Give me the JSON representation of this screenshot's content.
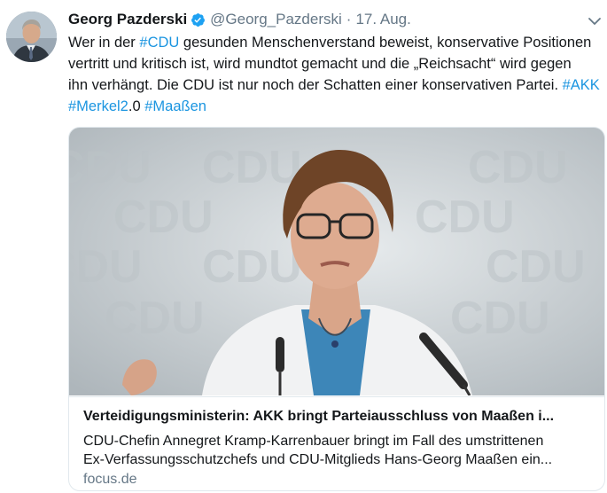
{
  "tweet": {
    "author_name": "Georg Pazderski",
    "handle": "@Georg_Pazderski",
    "separator": "·",
    "date": "17. Aug.",
    "text_lines": [
      [
        {
          "t": "Wer in der ",
          "tag": false
        },
        {
          "t": "#CDU",
          "tag": true
        },
        {
          "t": " gesunden Menschenverstand beweist, konservative Positionen",
          "tag": false
        }
      ],
      [
        {
          "t": "vertritt und kritisch ist, wird mundtot gemacht und  die „Reichsacht“ wird gegen",
          "tag": false
        }
      ],
      [
        {
          "t": "ihn verhängt. Die CDU ist nur noch der Schatten einer konservativen Partei. ",
          "tag": false
        },
        {
          "t": "#AKK",
          "tag": true
        }
      ],
      [
        {
          "t": "#Merkel2",
          "tag": true
        },
        {
          "t": ".0 ",
          "tag": false
        },
        {
          "t": "#Maaßen",
          "tag": true
        }
      ]
    ]
  },
  "card": {
    "image_wall_text": "CDU",
    "title": "Verteidigungsministerin: AKK bringt Parteiausschluss von Maaßen i...",
    "description_lines": [
      "CDU-Chefin Annegret Kramp-Karrenbauer bringt im Fall des umstrittenen",
      "Ex-Verfassungsschutzchefs und CDU-Mitglieds Hans-Georg Maaßen ein..."
    ],
    "domain": "focus.de"
  },
  "colors": {
    "link": "#1b95e0",
    "secondary_text": "#657786",
    "verified_badge": "#1da1f2",
    "border": "#e1e8ed"
  },
  "icons": {
    "verified": "verified-badge-icon",
    "menu": "chevron-down-icon"
  }
}
